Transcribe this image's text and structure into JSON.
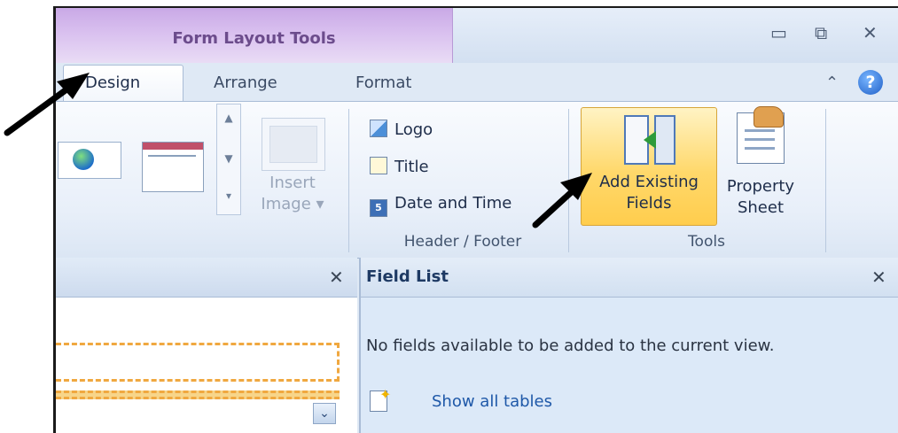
{
  "title_bar": {
    "context_title": "Form Layout Tools",
    "window_controls": [
      "minimize-icon",
      "restore-icon",
      "close-icon"
    ]
  },
  "tabs": [
    "Design",
    "Arrange",
    "Format"
  ],
  "ribbon": {
    "gallery": {
      "insert_image_label": "Insert Image",
      "insert_image_dropdown": "▾"
    },
    "header_footer": {
      "items": [
        "Logo",
        "Title",
        "Date and Time"
      ],
      "group_label": "Header / Footer"
    },
    "tools": {
      "add_existing_fields": "Add Existing Fields",
      "property_sheet": "Property Sheet",
      "group_label": "Tools"
    }
  },
  "field_list": {
    "title": "Field List",
    "message": "No fields available to be added to the current view.",
    "show_all_tables": "Show all tables"
  },
  "colors": {
    "context_tab": "#d9c0ef",
    "selected_button": "#ffd86b",
    "annotation_arrow": "#000000"
  }
}
